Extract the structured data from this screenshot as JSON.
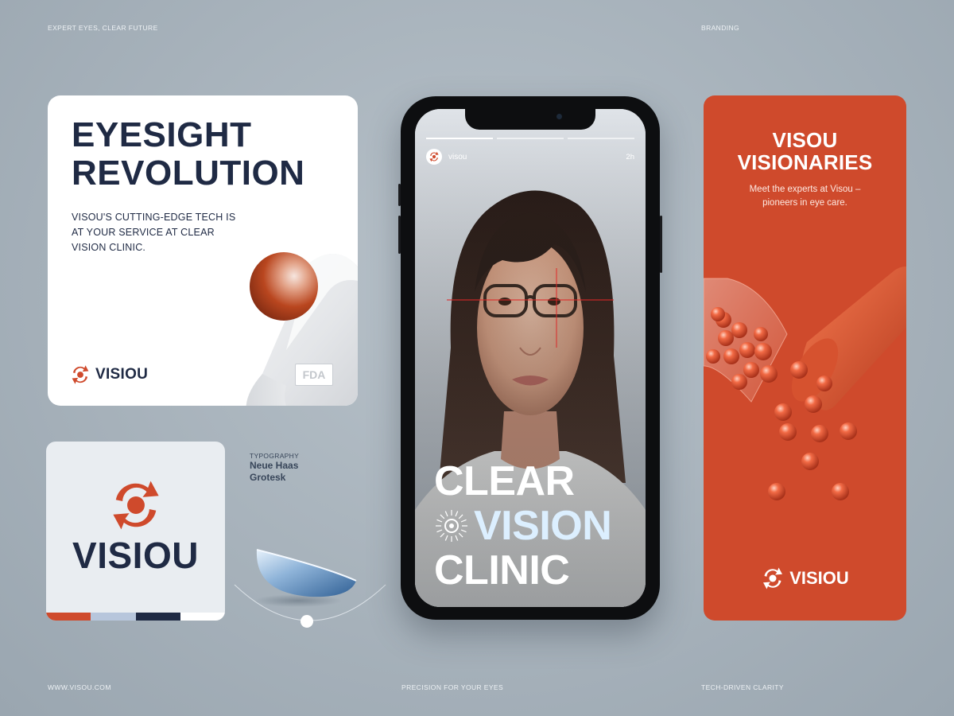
{
  "corners": {
    "top_left": "EXPERT EYES, CLEAR FUTURE",
    "top_right": "BRANDING",
    "bottom_left": "WWW.VISOU.COM",
    "bottom_center": "PRECISION FOR YOUR EYES",
    "bottom_right": "TECH-DRIVEN CLARITY"
  },
  "card1": {
    "headline": [
      "EYESIGHT",
      "REVOLUTION"
    ],
    "body": [
      "VISOU'S CUTTING-EDGE TECH IS",
      "AT YOUR SERVICE AT CLEAR",
      "VISION CLINIC."
    ],
    "brand": "VISIOU",
    "badge": "FDA"
  },
  "card2": {
    "wordmark": "VISIOU",
    "swatches": [
      "#cf4a2c",
      "#b7c6dc",
      "#1f2a44",
      "#ffffff"
    ]
  },
  "typography": {
    "label": "TYPOGRAPHY",
    "font_lines": [
      "Neue Haas",
      "Grotesk"
    ]
  },
  "phone": {
    "handle": "visou",
    "time": "2h",
    "headline": [
      "CLEAR",
      "VISION",
      "CLINIC"
    ]
  },
  "card3": {
    "title": [
      "VISOU",
      "VISIONARIES"
    ],
    "subtitle": [
      "Meet the experts at Visou –",
      "pioneers in eye care."
    ],
    "brand": "VISIOU"
  },
  "colors": {
    "accent": "#cf4a2c",
    "navy": "#1f2a44",
    "light_blue": "#b7c6dc",
    "background": "#a9b4bd"
  },
  "icons": [
    "visiou-logo-icon",
    "fda-badge",
    "contact-lens",
    "sunburst-eye-icon"
  ]
}
